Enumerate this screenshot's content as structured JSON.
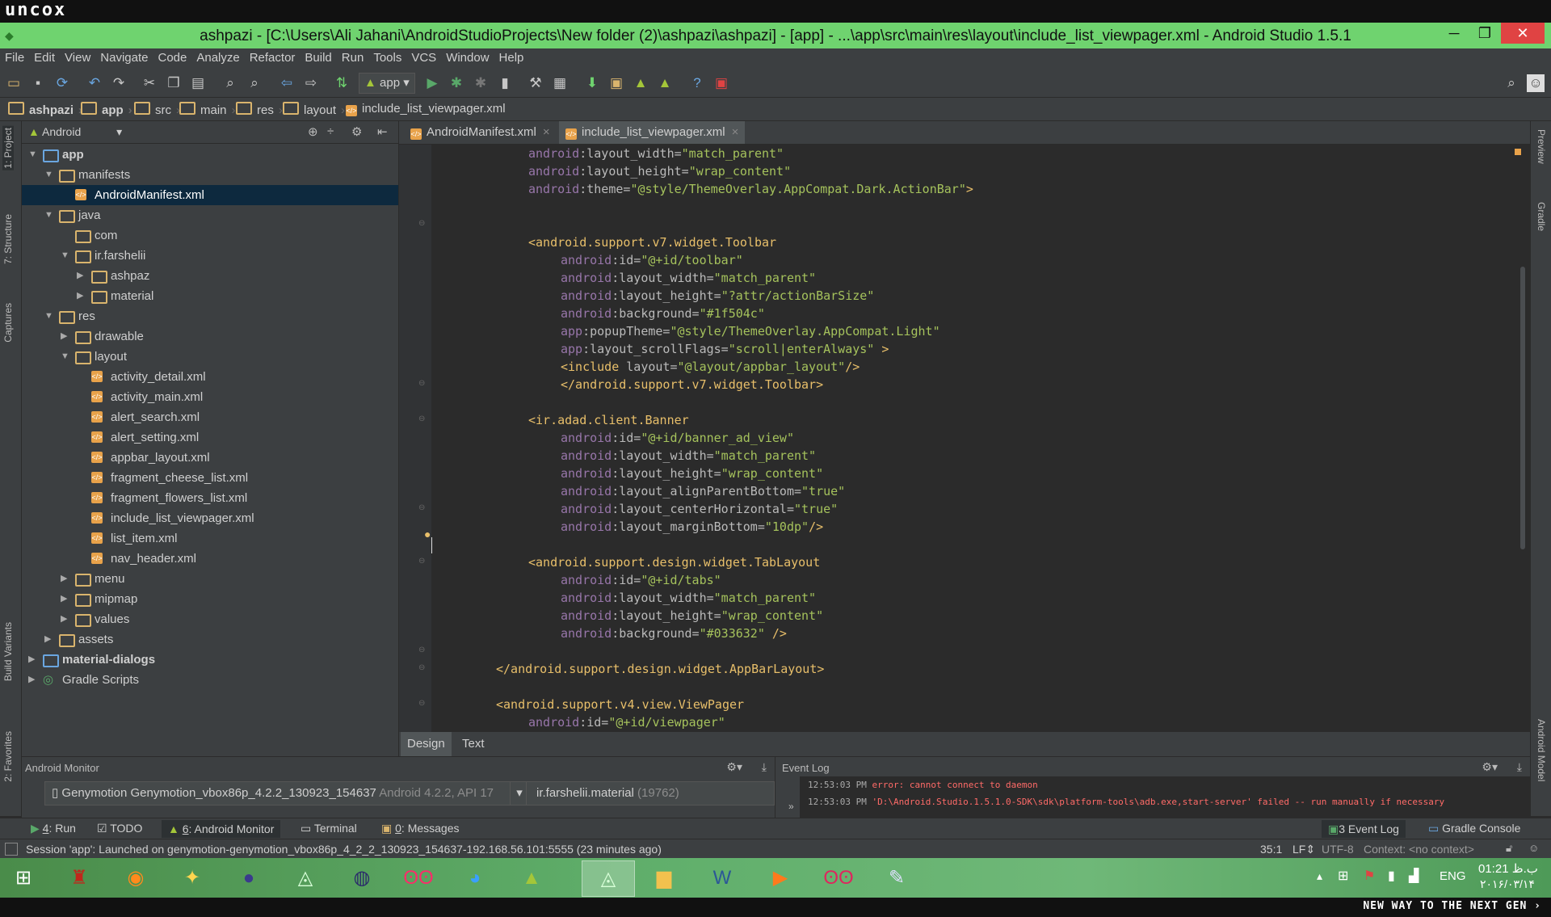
{
  "watermark": {
    "logo": "uncox",
    "slogan": "NEW WAY TO THE NEXT GEN ›"
  },
  "window": {
    "title": "ashpazi - [C:\\Users\\Ali Jahani\\AndroidStudioProjects\\New folder (2)\\ashpazi\\ashpazi] - [app] - ...\\app\\src\\main\\res\\layout\\include_list_viewpager.xml - Android Studio 1.5.1",
    "minimize": "─",
    "maximize": "❐",
    "close": "✕"
  },
  "menu": [
    "File",
    "Edit",
    "View",
    "Navigate",
    "Code",
    "Analyze",
    "Refactor",
    "Build",
    "Run",
    "Tools",
    "VCS",
    "Window",
    "Help"
  ],
  "toolbar": {
    "run_config": "app"
  },
  "breadcrumb": [
    "ashpazi",
    "app",
    "src",
    "main",
    "res",
    "layout",
    "include_list_viewpager.xml"
  ],
  "left_stripe": [
    "1: Project",
    "7: Structure",
    "Captures",
    "Build Variants",
    "2: Favorites"
  ],
  "right_stripe": [
    "Preview",
    "Gradle",
    "Android Model"
  ],
  "project": {
    "view": "Android",
    "tree": [
      {
        "label": "app",
        "depth": 0,
        "open": true,
        "bold": true,
        "icon": "module"
      },
      {
        "label": "manifests",
        "depth": 1,
        "open": true,
        "icon": "folder"
      },
      {
        "label": "AndroidManifest.xml",
        "depth": 2,
        "icon": "xml",
        "selected": true
      },
      {
        "label": "java",
        "depth": 1,
        "open": true,
        "icon": "folder"
      },
      {
        "label": "com",
        "depth": 2,
        "icon": "folder"
      },
      {
        "label": "ir.farshelii",
        "depth": 2,
        "open": true,
        "icon": "folder"
      },
      {
        "label": "ashpaz",
        "depth": 3,
        "closed": true,
        "icon": "folder"
      },
      {
        "label": "material",
        "depth": 3,
        "closed": true,
        "icon": "folder"
      },
      {
        "label": "res",
        "depth": 1,
        "open": true,
        "icon": "folder"
      },
      {
        "label": "drawable",
        "depth": 2,
        "closed": true,
        "icon": "folder"
      },
      {
        "label": "layout",
        "depth": 2,
        "open": true,
        "icon": "folder"
      },
      {
        "label": "activity_detail.xml",
        "depth": 3,
        "icon": "xml"
      },
      {
        "label": "activity_main.xml",
        "depth": 3,
        "icon": "xml"
      },
      {
        "label": "alert_search.xml",
        "depth": 3,
        "icon": "xml"
      },
      {
        "label": "alert_setting.xml",
        "depth": 3,
        "icon": "xml"
      },
      {
        "label": "appbar_layout.xml",
        "depth": 3,
        "icon": "xml"
      },
      {
        "label": "fragment_cheese_list.xml",
        "depth": 3,
        "icon": "xml"
      },
      {
        "label": "fragment_flowers_list.xml",
        "depth": 3,
        "icon": "xml"
      },
      {
        "label": "include_list_viewpager.xml",
        "depth": 3,
        "icon": "xml"
      },
      {
        "label": "list_item.xml",
        "depth": 3,
        "icon": "xml"
      },
      {
        "label": "nav_header.xml",
        "depth": 3,
        "icon": "xml"
      },
      {
        "label": "menu",
        "depth": 2,
        "closed": true,
        "icon": "folder"
      },
      {
        "label": "mipmap",
        "depth": 2,
        "closed": true,
        "icon": "folder"
      },
      {
        "label": "values",
        "depth": 2,
        "closed": true,
        "icon": "folder"
      },
      {
        "label": "assets",
        "depth": 1,
        "closed": true,
        "icon": "folder"
      },
      {
        "label": "material-dialogs",
        "depth": 0,
        "closed": true,
        "bold": true,
        "icon": "module"
      },
      {
        "label": "Gradle Scripts",
        "depth": 0,
        "closed": true,
        "icon": "gradle"
      }
    ]
  },
  "editor": {
    "tabs": [
      {
        "label": "AndroidManifest.xml",
        "active": false
      },
      {
        "label": "include_list_viewpager.xml",
        "active": true
      }
    ],
    "lines": [
      {
        "indent": 3,
        "t": [
          [
            "ns",
            "android"
          ],
          [
            "attr",
            ":layout_width="
          ],
          [
            "val",
            "\"match_parent\""
          ]
        ]
      },
      {
        "indent": 3,
        "t": [
          [
            "ns",
            "android"
          ],
          [
            "attr",
            ":layout_height="
          ],
          [
            "val",
            "\"wrap_content\""
          ]
        ]
      },
      {
        "indent": 3,
        "t": [
          [
            "ns",
            "android"
          ],
          [
            "attr",
            ":theme="
          ],
          [
            "val",
            "\"@style/ThemeOverlay.AppCompat.Dark.ActionBar\""
          ],
          [
            "tag",
            ">"
          ]
        ]
      },
      {
        "indent": 0,
        "t": []
      },
      {
        "indent": 0,
        "t": []
      },
      {
        "indent": 3,
        "t": [
          [
            "tag",
            "<android.support.v7.widget.Toolbar"
          ]
        ]
      },
      {
        "indent": 4,
        "t": [
          [
            "ns",
            "android"
          ],
          [
            "attr",
            ":id="
          ],
          [
            "val",
            "\"@+id/toolbar\""
          ]
        ]
      },
      {
        "indent": 4,
        "t": [
          [
            "ns",
            "android"
          ],
          [
            "attr",
            ":layout_width="
          ],
          [
            "val",
            "\"match_parent\""
          ]
        ]
      },
      {
        "indent": 4,
        "t": [
          [
            "ns",
            "android"
          ],
          [
            "attr",
            ":layout_height="
          ],
          [
            "val",
            "\"?attr/actionBarSize\""
          ]
        ]
      },
      {
        "indent": 4,
        "t": [
          [
            "ns",
            "android"
          ],
          [
            "attr",
            ":background="
          ],
          [
            "val",
            "\"#1f504c\""
          ]
        ]
      },
      {
        "indent": 4,
        "t": [
          [
            "ns",
            "app"
          ],
          [
            "attr",
            ":popupTheme="
          ],
          [
            "val",
            "\"@style/ThemeOverlay.AppCompat.Light\""
          ]
        ]
      },
      {
        "indent": 4,
        "t": [
          [
            "ns",
            "app"
          ],
          [
            "attr",
            ":layout_scrollFlags="
          ],
          [
            "val",
            "\"scroll|enterAlways\""
          ],
          [
            "tag",
            " >"
          ]
        ]
      },
      {
        "indent": 4,
        "t": [
          [
            "tag",
            "<include "
          ],
          [
            "attr",
            "layout="
          ],
          [
            "val",
            "\"@layout/appbar_layout\""
          ],
          [
            "tag",
            "/>"
          ]
        ]
      },
      {
        "indent": 4,
        "t": [
          [
            "tag",
            "</android.support.v7.widget.Toolbar>"
          ]
        ]
      },
      {
        "indent": 0,
        "t": []
      },
      {
        "indent": 3,
        "t": [
          [
            "tag",
            "<ir.adad.client.Banner"
          ]
        ]
      },
      {
        "indent": 4,
        "t": [
          [
            "ns",
            "android"
          ],
          [
            "attr",
            ":id="
          ],
          [
            "val",
            "\"@+id/banner_ad_view\""
          ]
        ]
      },
      {
        "indent": 4,
        "t": [
          [
            "ns",
            "android"
          ],
          [
            "attr",
            ":layout_width="
          ],
          [
            "val",
            "\"match_parent\""
          ]
        ]
      },
      {
        "indent": 4,
        "t": [
          [
            "ns",
            "android"
          ],
          [
            "attr",
            ":layout_height="
          ],
          [
            "val",
            "\"wrap_content\""
          ]
        ]
      },
      {
        "indent": 4,
        "t": [
          [
            "ns",
            "android"
          ],
          [
            "attr",
            ":layout_alignParentBottom="
          ],
          [
            "val",
            "\"true\""
          ]
        ]
      },
      {
        "indent": 4,
        "t": [
          [
            "ns",
            "android"
          ],
          [
            "attr",
            ":layout_centerHorizontal="
          ],
          [
            "val",
            "\"true\""
          ]
        ]
      },
      {
        "indent": 4,
        "t": [
          [
            "ns",
            "android"
          ],
          [
            "attr",
            ":layout_marginBottom="
          ],
          [
            "val",
            "\"10dp\""
          ],
          [
            "tag",
            "/>"
          ]
        ]
      },
      {
        "indent": 0,
        "t": []
      },
      {
        "indent": 3,
        "t": [
          [
            "tag",
            "<android.support.design.widget.TabLayout"
          ]
        ]
      },
      {
        "indent": 4,
        "t": [
          [
            "ns",
            "android"
          ],
          [
            "attr",
            ":id="
          ],
          [
            "val",
            "\"@+id/tabs\""
          ]
        ]
      },
      {
        "indent": 4,
        "t": [
          [
            "ns",
            "android"
          ],
          [
            "attr",
            ":layout_width="
          ],
          [
            "val",
            "\"match_parent\""
          ]
        ]
      },
      {
        "indent": 4,
        "t": [
          [
            "ns",
            "android"
          ],
          [
            "attr",
            ":layout_height="
          ],
          [
            "val",
            "\"wrap_content\""
          ]
        ]
      },
      {
        "indent": 4,
        "t": [
          [
            "ns",
            "android"
          ],
          [
            "attr",
            ":background="
          ],
          [
            "val",
            "\"#033632\""
          ],
          [
            "tag",
            " />"
          ]
        ]
      },
      {
        "indent": 0,
        "t": []
      },
      {
        "indent": 2,
        "t": [
          [
            "tag",
            "</android.support.design.widget.AppBarLayout>"
          ]
        ]
      },
      {
        "indent": 0,
        "t": []
      },
      {
        "indent": 2,
        "t": [
          [
            "tag",
            "<android.support.v4.view.ViewPager"
          ]
        ]
      },
      {
        "indent": 3,
        "t": [
          [
            "ns",
            "android"
          ],
          [
            "attr",
            ":id="
          ],
          [
            "val",
            "\"@+id/viewpager\""
          ]
        ]
      }
    ],
    "design_tabs": [
      {
        "label": "Design",
        "active": true
      },
      {
        "label": "Text",
        "active": false
      }
    ]
  },
  "monitor": {
    "title": "Android Monitor",
    "device": "Genymotion Genymotion_vbox86p_4.2.2_130923_154637",
    "device_api": "Android 4.2.2, API 17",
    "process": "ir.farshelii.material",
    "pid": "(19762)"
  },
  "eventlog": {
    "title": "Event Log",
    "entries": [
      {
        "time": "12:53:03 PM",
        "text": "error: cannot connect to daemon"
      },
      {
        "time": "12:53:03 PM",
        "text": "'D:\\Android.Studio.1.5.1.0-SDK\\sdk\\platform-tools\\adb.exe,start-server' failed -- run manually if necessary"
      }
    ]
  },
  "toolwindows": {
    "left": [
      {
        "num": "4",
        "label": ": Run"
      },
      {
        "num": "",
        "label": "TODO"
      },
      {
        "num": "6",
        "label": ": Android Monitor"
      },
      {
        "num": "",
        "label": "Terminal"
      },
      {
        "num": "0",
        "label": ": Messages"
      }
    ],
    "right": [
      {
        "num": "3",
        "label": " Event Log"
      },
      {
        "num": "",
        "label": "Gradle Console"
      }
    ]
  },
  "status": {
    "message": "Session 'app': Launched on genymotion-genymotion_vbox86p_4_2_2_130923_154637-192.168.56.101:5555 (23 minutes ago)",
    "position": "35:1",
    "line_sep": "LF⇕",
    "encoding": "UTF-8",
    "context": "Context: <no context>"
  },
  "taskbar": {
    "lang": "ENG",
    "time": "01:21 ب.ظ",
    "date": "۲۰۱۶/۰۳/۱۴"
  },
  "colors": {
    "accent": "#6fd36f",
    "tag": "#e8bf6a",
    "ns": "#9876aa",
    "value": "#a5c25c",
    "error": "#ff6b68"
  }
}
